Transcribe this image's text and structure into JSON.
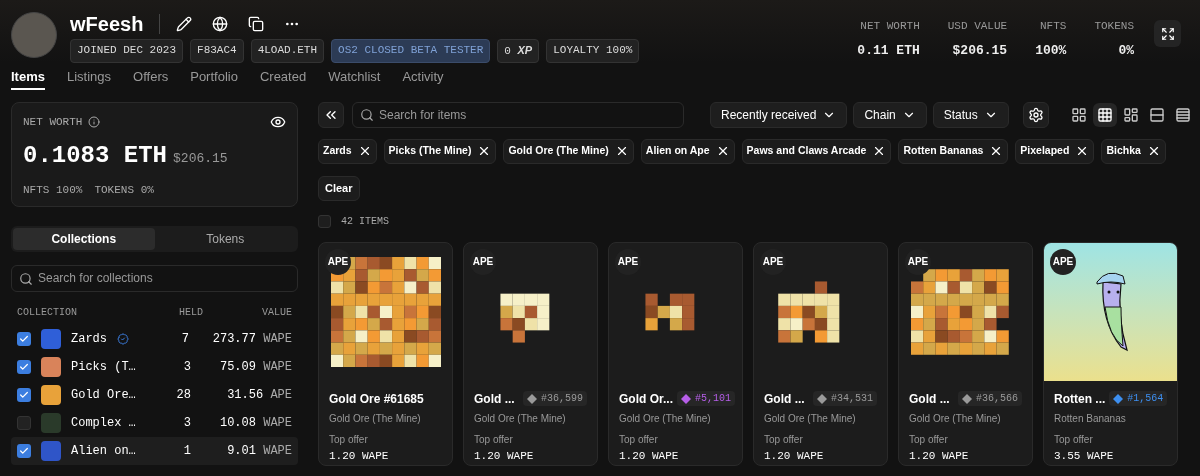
{
  "profile": {
    "name": "wFeesh",
    "badges": [
      {
        "kind": "plain",
        "text": "JOINED DEC 2023"
      },
      {
        "kind": "plain",
        "text": "F83AC4"
      },
      {
        "kind": "plain",
        "text": "4LOAD.ETH"
      },
      {
        "kind": "highlight",
        "text": "OS2 CLOSED BETA TESTER"
      },
      {
        "kind": "xp",
        "text": "0",
        "suffix": "XP"
      },
      {
        "kind": "plain",
        "text": "LOYALTY 100%"
      }
    ]
  },
  "stats": [
    {
      "label": "NET WORTH",
      "value": "0.11 ETH"
    },
    {
      "label": "USD VALUE",
      "value": "$206.15"
    },
    {
      "label": "NFTS",
      "value": "100%"
    },
    {
      "label": "TOKENS",
      "value": "0%"
    }
  ],
  "tabs": [
    {
      "label": "Items",
      "selected": true
    },
    {
      "label": "Listings",
      "selected": false
    },
    {
      "label": "Offers",
      "selected": false
    },
    {
      "label": "Portfolio",
      "selected": false
    },
    {
      "label": "Created",
      "selected": false
    },
    {
      "label": "Watchlist",
      "selected": false
    },
    {
      "label": "Activity",
      "selected": false
    }
  ],
  "net_worth_card": {
    "title": "NET WORTH",
    "amount": "0.1083 ETH",
    "usd": "$206.15",
    "split": [
      "NFTS 100%",
      "TOKENS 0%"
    ]
  },
  "sidebar_tabs": [
    {
      "label": "Collections",
      "selected": true
    },
    {
      "label": "Tokens",
      "selected": false
    }
  ],
  "collection_search": {
    "placeholder": "Search for collections"
  },
  "collections_table": {
    "columns": [
      "COLLECTION",
      "HELD",
      "VALUE"
    ],
    "rows": [
      {
        "name": "Zards",
        "verified": true,
        "held": "7",
        "value": "273.77",
        "currency": "WAPE",
        "checked": true,
        "selected": false,
        "color": "#2f5fd8"
      },
      {
        "name": "Picks (T…",
        "verified": false,
        "held": "3",
        "value": "75.09",
        "currency": "WAPE",
        "checked": true,
        "selected": false,
        "color": "#d9835a"
      },
      {
        "name": "Gold Ore…",
        "verified": false,
        "held": "28",
        "value": "31.56",
        "currency": "APE",
        "checked": true,
        "selected": false,
        "color": "#e8a23a"
      },
      {
        "name": "Complex …",
        "verified": false,
        "held": "3",
        "value": "10.08",
        "currency": "WAPE",
        "checked": false,
        "selected": false,
        "color": "#2a3a2a"
      },
      {
        "name": "Alien on…",
        "verified": false,
        "held": "1",
        "value": "9.01",
        "currency": "WAPE",
        "checked": true,
        "selected": true,
        "color": "#2f55c8"
      }
    ]
  },
  "item_search": {
    "placeholder": "Search for items"
  },
  "dropdowns": [
    "Recently received",
    "Chain",
    "Status"
  ],
  "views": [
    {
      "kind": "grid-large",
      "selected": false
    },
    {
      "kind": "grid-dense",
      "selected": true
    },
    {
      "kind": "grid-mixed",
      "selected": false
    },
    {
      "kind": "list",
      "selected": false
    },
    {
      "kind": "table",
      "selected": false
    }
  ],
  "filters": [
    "Zards",
    "Picks (The Mine)",
    "Gold Ore (The Mine)",
    "Alien on Ape",
    "Paws and Claws Arcade",
    "Rotten Bananas",
    "Pixelaped",
    "Bichka"
  ],
  "clear_button": "Clear",
  "item_count": {
    "text": "42 ITEMS",
    "checked": false
  },
  "items": [
    {
      "kind": "pixel",
      "chain": "APE",
      "title": "Gold Ore #61685",
      "collection": "Gold Ore (The Mine)",
      "offer_label": "Top offer",
      "offer": "1.20 WAPE"
    },
    {
      "kind": "pixel",
      "chain": "APE",
      "title": "Gold ...",
      "rank": "#36,599",
      "color": "#9a9a9a",
      "collection": "Gold Ore (The Mine)",
      "offer_label": "Top offer",
      "offer": "1.20 WAPE"
    },
    {
      "kind": "pixel",
      "chain": "APE",
      "title": "Gold Or...",
      "rank": "#5,101",
      "color": "#b65ee8",
      "collection": "Gold Ore (The Mine)",
      "offer_label": "Top offer",
      "offer": "1.20 WAPE"
    },
    {
      "kind": "pixel",
      "chain": "APE",
      "title": "Gold ...",
      "rank": "#34,531",
      "color": "#9a9a9a",
      "collection": "Gold Ore (The Mine)",
      "offer_label": "Top offer",
      "offer": "1.20 WAPE"
    },
    {
      "kind": "pixel",
      "chain": "APE",
      "title": "Gold ...",
      "rank": "#36,566",
      "color": "#9a9a9a",
      "collection": "Gold Ore (The Mine)",
      "offer_label": "Top offer",
      "offer": "1.20 WAPE"
    },
    {
      "kind": "character",
      "chain": "APE",
      "title": "Rotten ...",
      "rank": "#1,564",
      "color": "#3d8ff0",
      "collection": "Rotten Bananas",
      "offer_label": "Top offer",
      "offer": "3.55 WAPE"
    }
  ]
}
